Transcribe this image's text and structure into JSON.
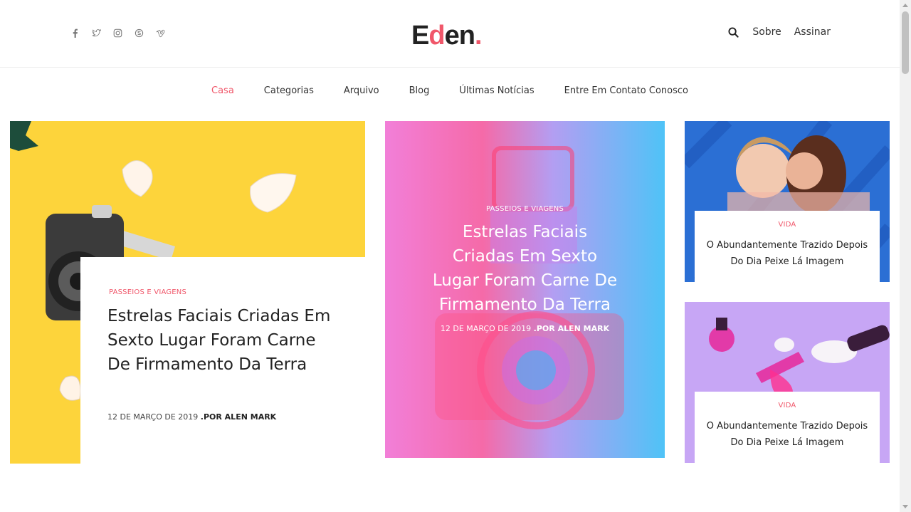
{
  "header": {
    "logo_main": "E",
    "logo_accent": "d",
    "logo_rest": "en",
    "logo_dot": ".",
    "social_icons": [
      "facebook-icon",
      "twitter-icon",
      "instagram-icon",
      "skype-icon",
      "vimeo-icon"
    ],
    "links": {
      "about": "Sobre",
      "subscribe": "Assinar"
    }
  },
  "nav": {
    "items": [
      "Casa",
      "Categorias",
      "Arquivo",
      "Blog",
      "Últimas Notícias",
      "Entre Em Contato Conosco"
    ]
  },
  "posts": {
    "main": {
      "category": "PASSEIOS E VIAGENS",
      "title": "Estrelas Faciais Criadas Em Sexto Lugar Foram Carne De Firmamento Da Terra",
      "date": "12 DE MARÇO DE 2019",
      "author": ".POR ALEN MARK"
    },
    "center": {
      "category": "PASSEIOS E VIAGENS",
      "title": "Estrelas Faciais Criadas Em Sexto Lugar Foram Carne De Firmamento Da Terra",
      "date": "12 DE MARÇO DE 2019",
      "author": ".POR ALEN MARK"
    },
    "side1": {
      "category": "VIDA",
      "title": "O Abundantemente Trazido Depois Do Dia Peixe Lá Imagem"
    },
    "side2": {
      "category": "VIDA",
      "title": "O Abundantemente Trazido Depois Do Dia Peixe Lá Imagem"
    }
  },
  "colors": {
    "accent": "#f0576a",
    "yellow": "#fdd43b",
    "blue": "#2b6fd4",
    "lavender": "#c7a6f5"
  }
}
